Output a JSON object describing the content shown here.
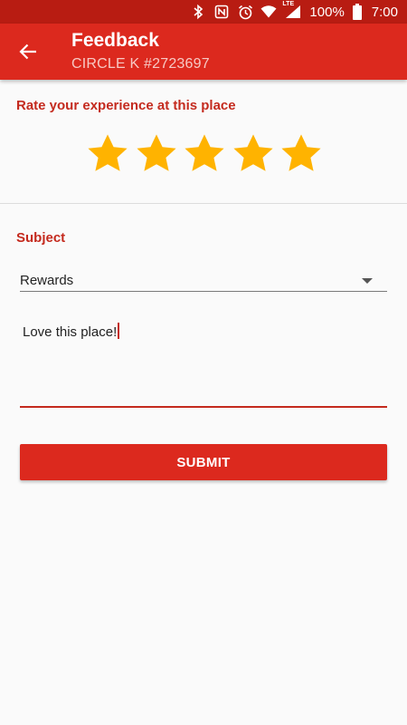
{
  "status_bar": {
    "battery_percent": "100%",
    "time": "7:00",
    "network_type": "LTE",
    "icons": [
      "bluetooth-icon",
      "nfc-icon",
      "alarm-icon",
      "wifi-icon",
      "signal-icon",
      "battery-icon"
    ]
  },
  "app_bar": {
    "title": "Feedback",
    "subtitle": "CIRCLE K #2723697",
    "back_icon": "arrow-left-icon"
  },
  "rating": {
    "label": "Rate your experience at this place",
    "value": 5,
    "max": 5,
    "star_color": "#FFB300"
  },
  "subject": {
    "label": "Subject",
    "selected": "Rewards"
  },
  "feedback": {
    "value": "Love this place!"
  },
  "submit": {
    "label": "SUBMIT"
  },
  "colors": {
    "primary": "#DC291E",
    "primary_dark": "#B81C12",
    "accent_text": "#C42A1E"
  }
}
